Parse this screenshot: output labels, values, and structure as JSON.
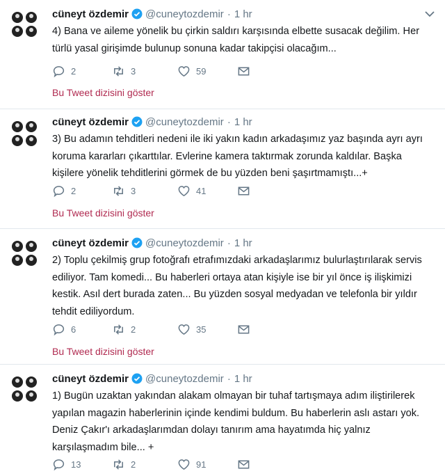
{
  "tweets": [
    {
      "name": "cüneyt özdemir",
      "handle": "@cuneytozdemir",
      "separator": "·",
      "time": "1 hr",
      "text": "4) Bana ve aileme yönelik bu çirkin saldırı karşısında elbette susacak değilim. Her\ntürlü yasal girişimde bulunup sonuna kadar takipçisi olacağım...",
      "replies": "2",
      "retweets": "3",
      "likes": "59",
      "thread_link": "Bu Tweet dizisini göster"
    },
    {
      "name": "cüneyt özdemir",
      "handle": "@cuneytozdemir",
      "separator": "·",
      "time": "1 hr",
      "text": "3) Bu adamın tehditleri nedeni ile iki yakın kadın arkadaşımız yaz başında ayrı ayrı\nkoruma kararları çıkarttılar. Evlerine kamera taktırmak zorunda kaldılar. Başka\nkişilere yönelik tehditlerini görmek de bu yüzden beni şaşırtmamıştı...+",
      "replies": "2",
      "retweets": "3",
      "likes": "41",
      "thread_link": "Bu Tweet dizisini göster"
    },
    {
      "name": "cüneyt özdemir",
      "handle": "@cuneytozdemir",
      "separator": "·",
      "time": "1 hr",
      "text": "2) Toplu çekilmiş grup fotoğrafı etrafımızdaki arkadaşlarımız bulurlaştırılarak servis\nediliyor. Tam komedi... Bu haberleri ortaya atan kişiyle ise bir yıl önce iş ilişkimizi\nkestik. Asıl dert burada zaten... Bu yüzden sosyal medyadan ve telefonla bir yıldır\ntehdit ediliyordum.",
      "replies": "6",
      "retweets": "2",
      "likes": "35",
      "thread_link": "Bu Tweet dizisini göster"
    },
    {
      "name": "cüneyt özdemir",
      "handle": "@cuneytozdemir",
      "separator": "·",
      "time": "1 hr",
      "text": "1) Bugün uzaktan yakından alakam olmayan bir tuhaf tartışmaya adım iliştirilerek\nyapılan magazin haberlerinin içinde kendimi buldum. Bu haberlerin aslı astarı yok.\nDeniz Çakır'ı arkadaşlarımdan dolayı tanırım ama hayatımda hiç yalnız\nkarşılaşmadım bile... +",
      "replies": "13",
      "retweets": "2",
      "likes": "91"
    }
  ],
  "icons": {
    "avatar": "avatar-grid-icon",
    "verified": "verified-badge-icon",
    "caret": "chevron-down-icon",
    "reply": "reply-icon",
    "retweet": "retweet-icon",
    "like": "heart-icon",
    "dm": "envelope-icon"
  },
  "colors": {
    "link": "#b02a50",
    "verified": "#1da1f2",
    "muted": "#657786",
    "text": "#14171a",
    "divider": "#e1e8ed"
  }
}
